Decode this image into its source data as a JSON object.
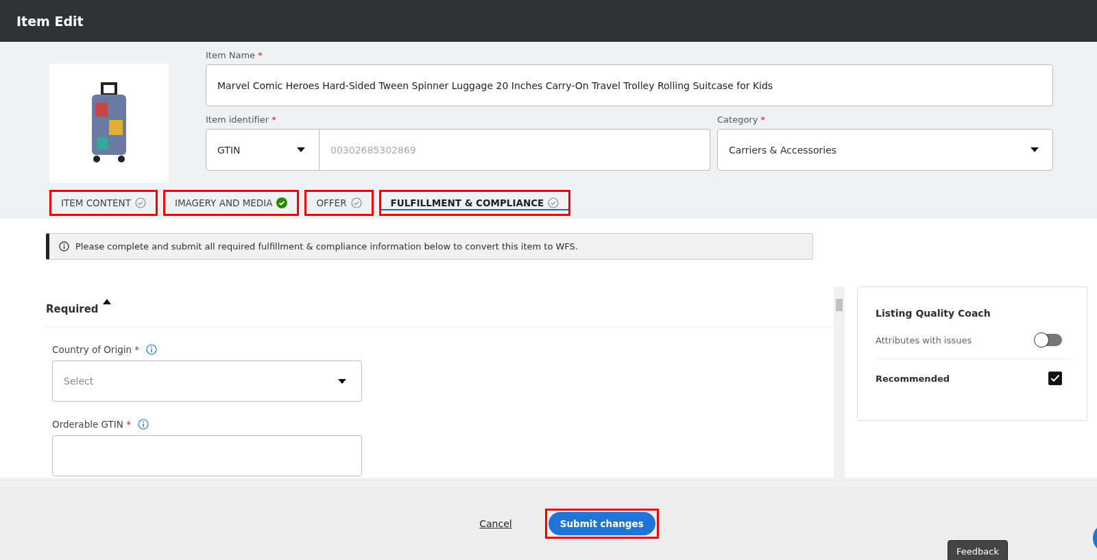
{
  "header": {
    "title": "Item Edit"
  },
  "item": {
    "name_label": "Item Name",
    "name_mark": "*",
    "identifier_mark": "*",
    "category_mark": "*",
    "name_value": "Marvel Comic Heroes Hard-Sided Tween Spinner Luggage 20 Inches Carry-On Travel Trolley Rolling Suitcase for Kids",
    "identifier_label": "Item identifier",
    "identifier_type": "GTIN",
    "identifier_placeholder": "00302685302869",
    "category_label": "Category",
    "category_value": "Carriers & Accessories"
  },
  "tabs": [
    {
      "label": "ITEM CONTENT",
      "selected": false,
      "complete": false,
      "highlighted": true
    },
    {
      "label": "IMAGERY AND MEDIA",
      "selected": false,
      "complete": true,
      "highlighted": true
    },
    {
      "label": "OFFER",
      "selected": false,
      "complete": false,
      "highlighted": true
    },
    {
      "label": "FULFILLMENT & COMPLIANCE",
      "selected": true,
      "complete": false,
      "highlighted": true
    }
  ],
  "notice": "Please complete and submit all required fulfillment & compliance information below to convert this item to WFS.",
  "section": {
    "title": "Required",
    "expanded": true,
    "fields": [
      {
        "label": "Country of Origin",
        "mark": "*",
        "kind": "select",
        "placeholder": "Select"
      },
      {
        "label": "Orderable GTIN",
        "mark": "*",
        "kind": "text"
      }
    ]
  },
  "coach": {
    "title": "Listing Quality Coach",
    "toggle_label": "Attributes with issues",
    "toggle_on": false,
    "check_label": "Recommended",
    "checked": true
  },
  "footer": {
    "cancel": "Cancel",
    "submit": "Submit changes",
    "submit_highlighted": true,
    "feedback": "Feedback"
  }
}
